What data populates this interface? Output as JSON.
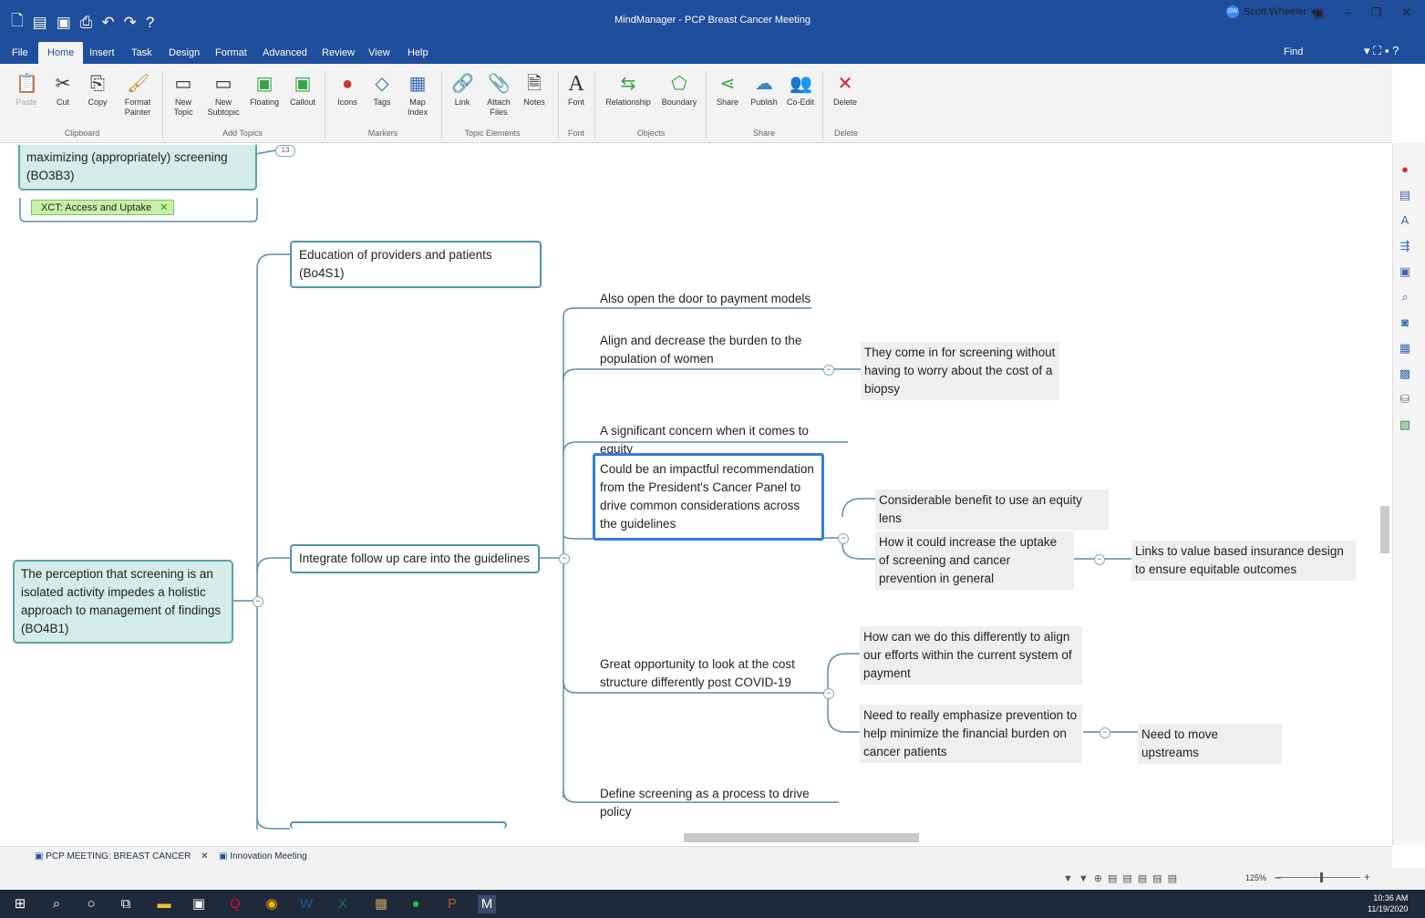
{
  "window": {
    "title": "MindManager - PCP Breast Cancer Meeting",
    "user": "Scott Wheeler",
    "user_initials": "SW"
  },
  "quick_access_icons": [
    "new-file-icon",
    "open-icon",
    "save-icon",
    "print-icon",
    "undo-icon",
    "redo-icon",
    "help-icon"
  ],
  "tabs": [
    "File",
    "Home",
    "Insert",
    "Task",
    "Design",
    "Format",
    "Advanced",
    "Review",
    "View",
    "Help"
  ],
  "find_label": "Find",
  "ribbon": {
    "buttons": [
      {
        "label": "Paste",
        "icon": "paste-icon"
      },
      {
        "label": "Cut",
        "icon": "cut-icon"
      },
      {
        "label": "Copy",
        "icon": "copy-icon"
      },
      {
        "label": "Format Painter",
        "icon": "format-painter-icon"
      },
      {
        "label": "New Topic",
        "icon": "new-topic-icon"
      },
      {
        "label": "New Subtopic",
        "icon": "new-subtopic-icon"
      },
      {
        "label": "Floating",
        "icon": "floating-icon"
      },
      {
        "label": "Callout",
        "icon": "callout-icon"
      },
      {
        "label": "Icons",
        "icon": "icons-icon"
      },
      {
        "label": "Tags",
        "icon": "tags-icon"
      },
      {
        "label": "Map Index",
        "icon": "map-index-icon"
      },
      {
        "label": "Link",
        "icon": "link-icon"
      },
      {
        "label": "Attach Files",
        "icon": "attach-icon"
      },
      {
        "label": "Notes",
        "icon": "notes-icon"
      },
      {
        "label": "Font",
        "icon": "font-icon"
      },
      {
        "label": "Relationship",
        "icon": "relationship-icon"
      },
      {
        "label": "Boundary",
        "icon": "boundary-icon"
      },
      {
        "label": "Share",
        "icon": "share-icon"
      },
      {
        "label": "Publish",
        "icon": "publish-icon"
      },
      {
        "label": "Co-Edit",
        "icon": "co-edit-icon"
      },
      {
        "label": "Delete",
        "icon": "delete-icon"
      }
    ],
    "groups": [
      "Clipboard",
      "Add Topics",
      "Markers",
      "Topic Elements",
      "Font",
      "Objects",
      "Share",
      "Delete"
    ]
  },
  "map": {
    "top_fragment": "maximizing (appropriately) screening (BO3B3)",
    "top_badge": "13",
    "tag": "XCT: Access and Uptake",
    "central": "The perception that screening is an isolated activity impedes a holistic approach to management of findings (BO4B1)",
    "topic_education": "Education of providers and patients (Bo4S1)",
    "topic_integrate": "Integrate follow up care into the guidelines",
    "sub_payment": "Also open the door to payment models",
    "sub_align": "Align and decrease the burden to the population of women",
    "note_biopsy": "They come in for screening without having to worry about the cost of a biopsy",
    "sub_equity": "A significant concern when it comes to equity",
    "selected_topic": "Could be an impactful recommendation from the President's Cancer Panel to drive common considerations across the guidelines",
    "note_equity_lens": "Considerable benefit to use an equity lens",
    "note_uptake": "How it could increase the uptake of screening and cancer prevention in general",
    "note_value": "Links to value based insurance design to ensure equitable outcomes",
    "sub_covid": "Great opportunity to look at the cost structure differently post COVID-19",
    "note_align_efforts": "How can we do this differently to align our efforts within the current system of payment",
    "note_prevention": "Need to really emphasize prevention to help minimize the financial burden on cancer patients",
    "note_upstream": "Need to move upstreams",
    "sub_define": "Define screening as a process to drive policy"
  },
  "doc_tabs": [
    "PCP MEETING: BREAST CANCER",
    "Innovation Meeting"
  ],
  "zoom": "125%",
  "clock": {
    "time": "10:36 AM",
    "date": "11/19/2020"
  },
  "taskbar_icons": [
    "windows-start-icon",
    "search-icon",
    "cortana-icon",
    "task-view-icon",
    "file-explorer-icon",
    "store-icon",
    "q-app-icon",
    "chrome-icon",
    "word-icon",
    "excel-icon",
    "calculator-icon",
    "spotify-icon",
    "powerpoint-icon",
    "mindmanager-icon"
  ]
}
